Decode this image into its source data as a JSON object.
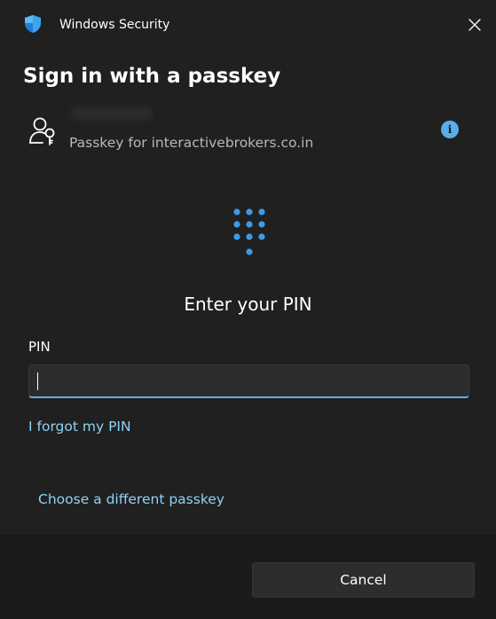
{
  "window": {
    "title": "Windows Security",
    "icons": {
      "app": "shield-icon",
      "close": "close-icon"
    }
  },
  "dialog": {
    "heading": "Sign in with a passkey",
    "account": {
      "icon": "passkey-user-icon",
      "description": "Passkey for interactivebrokers.co.in",
      "info_icon": "info-icon",
      "info_glyph": "i"
    },
    "pin_prompt": {
      "icon": "pin-pad-icon",
      "text": "Enter your PIN"
    },
    "pin_field": {
      "label": "PIN",
      "value": "",
      "placeholder": ""
    },
    "forgot_link": "I forgot my PIN",
    "choose_link": "Choose a different passkey"
  },
  "footer": {
    "cancel_label": "Cancel"
  },
  "colors": {
    "background": "#202020",
    "footer": "#1b1b1b",
    "accent": "#5fb2f2",
    "link": "#8fd2f6",
    "info": "#5aaee8",
    "muted_text": "#b8b8b8"
  }
}
